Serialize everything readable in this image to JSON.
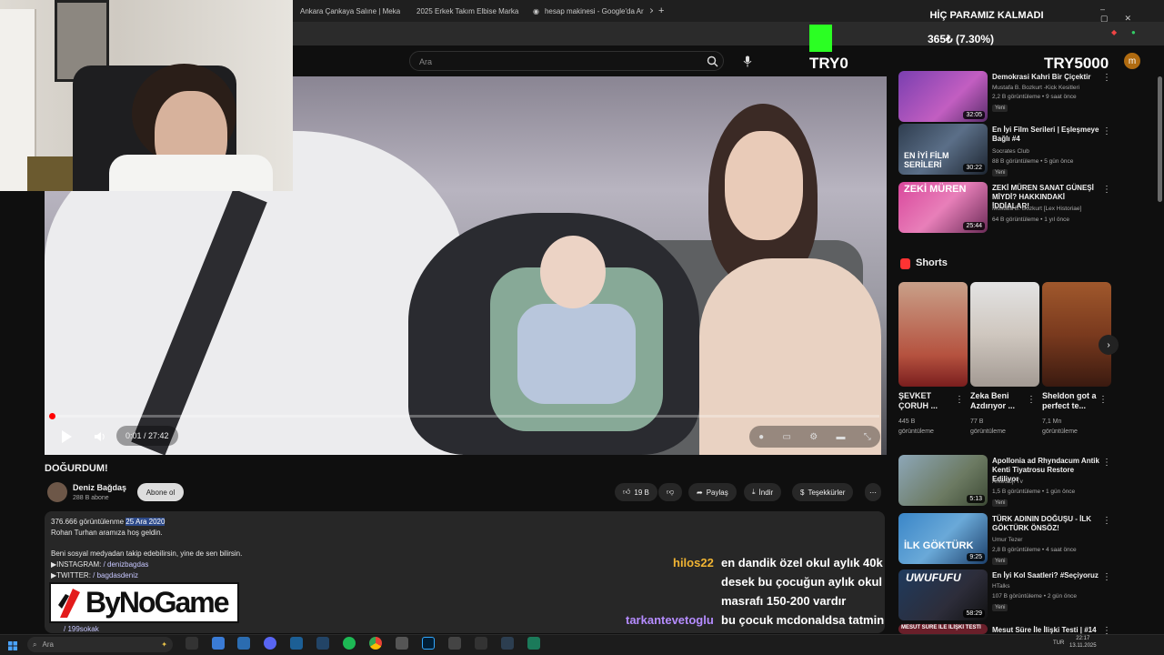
{
  "browser": {
    "tabs": [
      {
        "label": "Ankara Çankaya Salıne | Mekan"
      },
      {
        "label": "2025 Erkek Takım Elbise Marka"
      },
      {
        "label": "hesap makinesi - Google'da Ar"
      }
    ],
    "new_tab": "+"
  },
  "youtube": {
    "search_placeholder": "Ara",
    "user_initial": "m"
  },
  "video": {
    "title": "DOĞURDUM!",
    "timecode": "0:01 / 27:42",
    "progress_fraction": 0.0004
  },
  "channel": {
    "name": "Deniz Bağdaş",
    "subscribers": "288 B abone",
    "subscribe_label": "Abone ol"
  },
  "actions": {
    "likes": "19 B",
    "share": "Paylaş",
    "download": "İndir",
    "thanks": "Teşekkürler",
    "more": "⋯"
  },
  "description": {
    "views": "376.666 görüntülenme",
    "date": "25 Ara 2020",
    "lines": [
      "Rohan Turhan aramıza hoş geldin.",
      "Beni sosyal medyadan takip edebilirsin, yine de sen bilirsin.",
      "▶INSTAGRAM:",
      "▶TWITTER:",
      "/ 199sokak"
    ],
    "instagram_handle": "/ denizbagdas",
    "twitter_handle": "/ bagdasdeniz"
  },
  "stream_logo": {
    "text": "ByNoGame"
  },
  "chat": [
    {
      "user": "hilos22",
      "color": "#f0b433",
      "message": "en dandik özel okul aylık 40k desek bu çocuğun aylık okul masrafı 150-200 vardır"
    },
    {
      "user": "tarkantevetoglu",
      "color": "#b58cff",
      "message": "bu çocuk mcdonaldsa tatmin olmaz........"
    }
  ],
  "overlay": {
    "title": "HİÇ PARAMIZ KALMADI",
    "current": "365₺ (7.30%)",
    "low_label": "TRY0",
    "high_label": "TRY5000",
    "progress_fraction": 0.073,
    "bar_color": "#2bff23"
  },
  "sidebar": {
    "videos_top": [
      {
        "title": "Demokrasi Kahri Bir Çiçektir",
        "channel": "Mustafa B. Bozkurt -Kick Kesitleri",
        "meta": "2,2 B görüntüleme • 9 saat önce",
        "badge": "Yeni",
        "duration": "32:05"
      },
      {
        "title": "En İyi Film Serileri | Eşleşmeye Bağlı #4",
        "channel": "Socrates Club",
        "meta": "88 B görüntüleme • 5 gün önce",
        "badge": "Yeni",
        "duration": "30:22"
      },
      {
        "title": "ZEKİ MÜREN SANAT GÜNEŞİ MİYDİ? HAKKINDAKİ İDDİALAR!",
        "channel": "Mustafa B. Bozkurt [Lex Historiae]",
        "meta": "64 B görüntüleme • 1 yıl önce",
        "badge": "",
        "duration": "25:44"
      }
    ],
    "shorts_label": "Shorts",
    "shorts": [
      {
        "title": "ŞEVKET ÇORUH ...",
        "views": "445 B",
        "views_unit": "görüntüleme"
      },
      {
        "title": "Zeka Beni Azdırıyor ...",
        "views": "77 B",
        "views_unit": "görüntüleme"
      },
      {
        "title": "Sheldon got a perfect te...",
        "views": "7,1 Mn",
        "views_unit": "görüntüleme"
      }
    ],
    "videos_bottom": [
      {
        "title": "Apollonia ad Rhyndacum Antik Kenti Tiyatrosu Restore Ediliyor",
        "channel": "Arkeoloji Tv",
        "meta": "1,5 B görüntüleme • 1 gün önce",
        "badge": "Yeni",
        "duration": "5:13"
      },
      {
        "title": "TÜRK ADININ DOĞUŞU - İLK GÖKTÜRK ÖNSÖZ!",
        "channel": "Umur Tezer",
        "meta": "2,8 B görüntüleme • 4 saat önce",
        "badge": "Yeni",
        "duration": "9:25"
      },
      {
        "title": "En İyi Kol Saatleri? #Seçiyoruz",
        "channel": "HTalks",
        "meta": "107 B görüntüleme • 2 gün önce",
        "badge": "Yeni",
        "duration": "58:29"
      },
      {
        "title": "Mesut Süre İle İlişki Testi | #14",
        "channel": "",
        "meta": "",
        "badge": "",
        "duration": ""
      }
    ],
    "thumb_texts": {
      "film": "EN İYİ FİLM SERİLERİ",
      "zeki": "ZEKİ MÜREN",
      "gokturk": "İLK GÖKTÜRK",
      "uwufufu": "UWUFUFU",
      "mesut": "MESUT SÜRE İLE İLİŞKİ TESTİ"
    }
  },
  "taskbar": {
    "search_placeholder": "Ara",
    "lang": "TUR",
    "time": "22:17",
    "date": "13.11.2025"
  }
}
